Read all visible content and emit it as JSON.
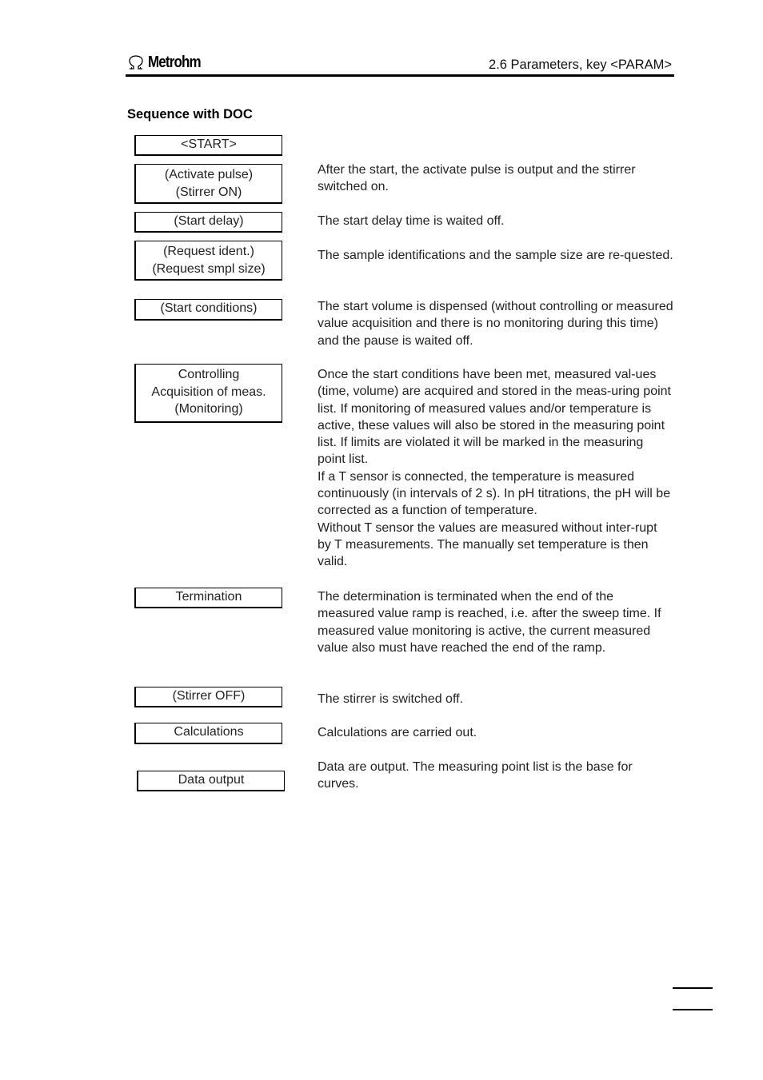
{
  "header": {
    "brand": "Metrohm",
    "brand_icon": "omega-logo-icon",
    "section_ref": "2.6 Parameters, key <PARAM>"
  },
  "section_title": "Sequence with DOC",
  "steps": [
    {
      "box": [
        "<START>"
      ],
      "description": []
    },
    {
      "box": [
        "(Activate pulse)",
        "(Stirrer ON)"
      ],
      "description": [
        "After the start, the activate pulse is output and the stirrer switched on."
      ]
    },
    {
      "box": [
        "(Start delay)"
      ],
      "description": [
        "The start delay time is waited off."
      ]
    },
    {
      "box": [
        "(Request ident.)",
        "(Request smpl size)"
      ],
      "description": [
        "The sample identifications and the sample size are re-quested."
      ]
    },
    {
      "box": [
        "(Start conditions)"
      ],
      "description": [
        "The start volume is dispensed (without controlling or measured value acquisition and there is no monitoring during this time) and the pause is waited off."
      ]
    },
    {
      "box": [
        "Controlling",
        "Acquisition of meas.",
        "(Monitoring)"
      ],
      "description": [
        "Once the start conditions have been met, measured val-ues (time, volume) are acquired and stored in the meas-uring point list. If monitoring of measured values and/or temperature is active, these values will also be stored in the measuring point list. If limits are violated it will be marked in the measuring point list.",
        "If a T sensor is connected, the temperature is measured continuously (in intervals of 2 s). In pH titrations, the pH will be corrected as a function of temperature.",
        "Without T sensor the values are measured without inter-rupt by T measurements. The manually set temperature is then valid."
      ]
    },
    {
      "box": [
        "Termination"
      ],
      "description": [
        "The determination is terminated when the end of the measured value ramp is reached, i.e. after the sweep time. If measured value monitoring is active, the current measured value also must have reached the end of the ramp."
      ]
    },
    {
      "box": [
        "(Stirrer OFF)"
      ],
      "description": [
        "The stirrer is switched off."
      ]
    },
    {
      "box": [
        "Calculations"
      ],
      "description": [
        "Calculations are carried out."
      ]
    },
    {
      "box": [
        "Data output"
      ],
      "description": [
        "Data are output. The measuring point list is the base for curves."
      ]
    }
  ]
}
